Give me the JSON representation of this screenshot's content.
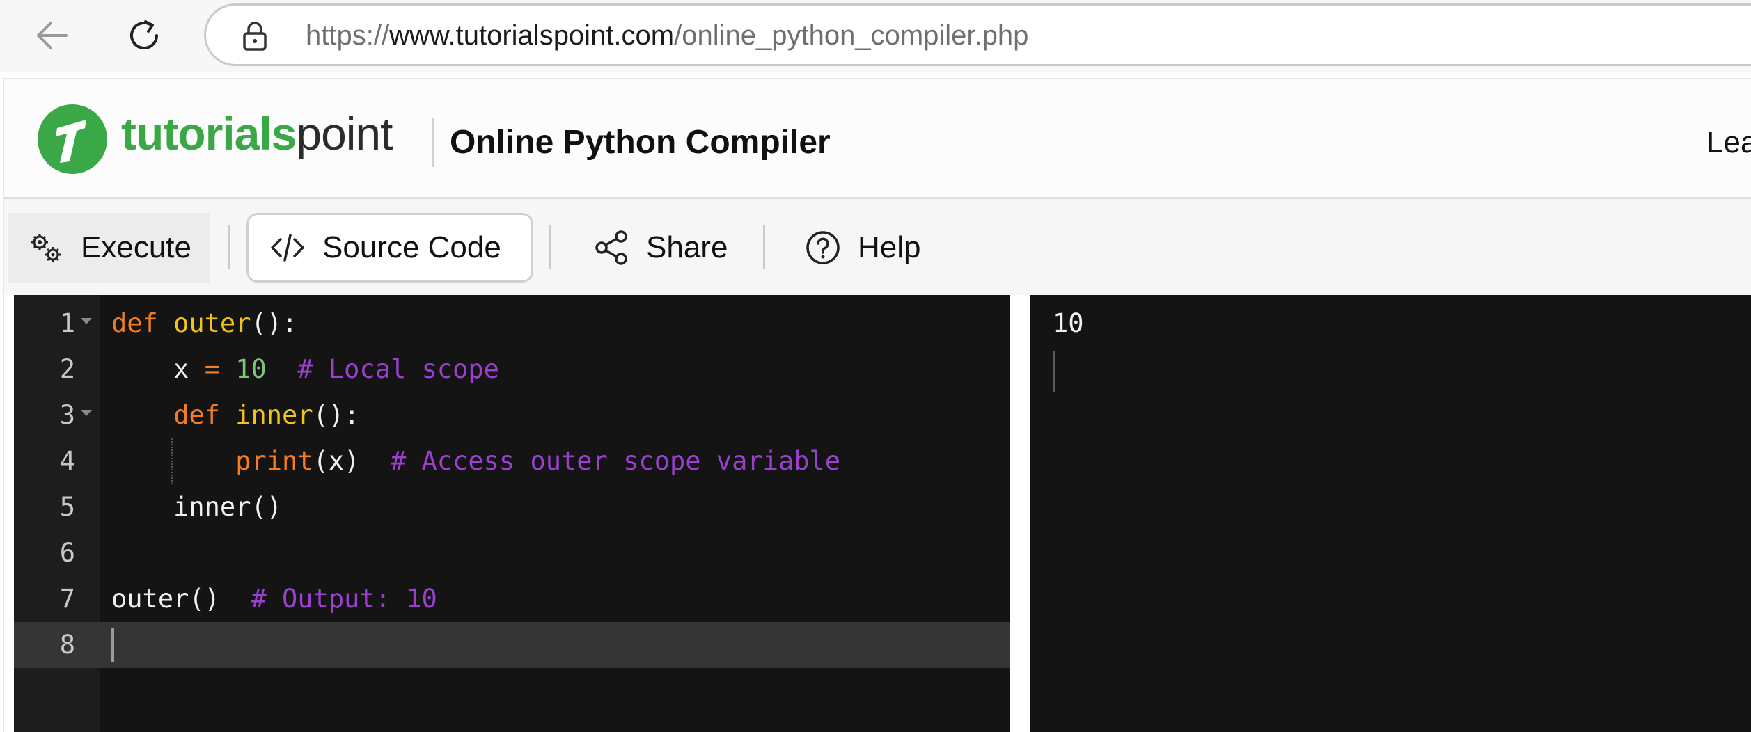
{
  "browser": {
    "url_scheme": "https://",
    "url_host": "www.tutorialspoint.com",
    "url_path": "/online_python_compiler.php"
  },
  "header": {
    "logo_bold": "tutorials",
    "logo_regular": "point",
    "title": "Online Python Compiler",
    "right_text": "Lea"
  },
  "toolbar": {
    "execute_label": "Execute",
    "source_label": "Source Code",
    "share_label": "Share",
    "help_label": "Help"
  },
  "editor": {
    "language": "python",
    "line_numbers": [
      "1",
      "2",
      "3",
      "4",
      "5",
      "6",
      "7",
      "8"
    ],
    "line1": {
      "kw": "def",
      "sp": " ",
      "fn": "outer",
      "rest": "():"
    },
    "line2": {
      "indent": "    ",
      "var": "x",
      "sp1": " ",
      "op": "=",
      "sp2": " ",
      "num": "10",
      "sp3": "  ",
      "cm": "# Local scope"
    },
    "line3": {
      "indent": "    ",
      "kw": "def",
      "sp": " ",
      "fn": "inner",
      "rest": "():"
    },
    "line4": {
      "indent": "        ",
      "bi": "print",
      "args": "(x)",
      "sp": "  ",
      "cm": "# Access outer scope variable"
    },
    "line5": {
      "indent": "    ",
      "call": "inner()"
    },
    "line7": {
      "call": "outer()",
      "sp": "  ",
      "cm": "# Output: 10"
    },
    "colors": {
      "keyword": "#f57d1f",
      "function": "#f2c318",
      "number": "#7fc476",
      "comment": "#9b3fd0",
      "background": "#141414"
    }
  },
  "output": {
    "text": "10"
  },
  "brand_color": "#3ba847"
}
